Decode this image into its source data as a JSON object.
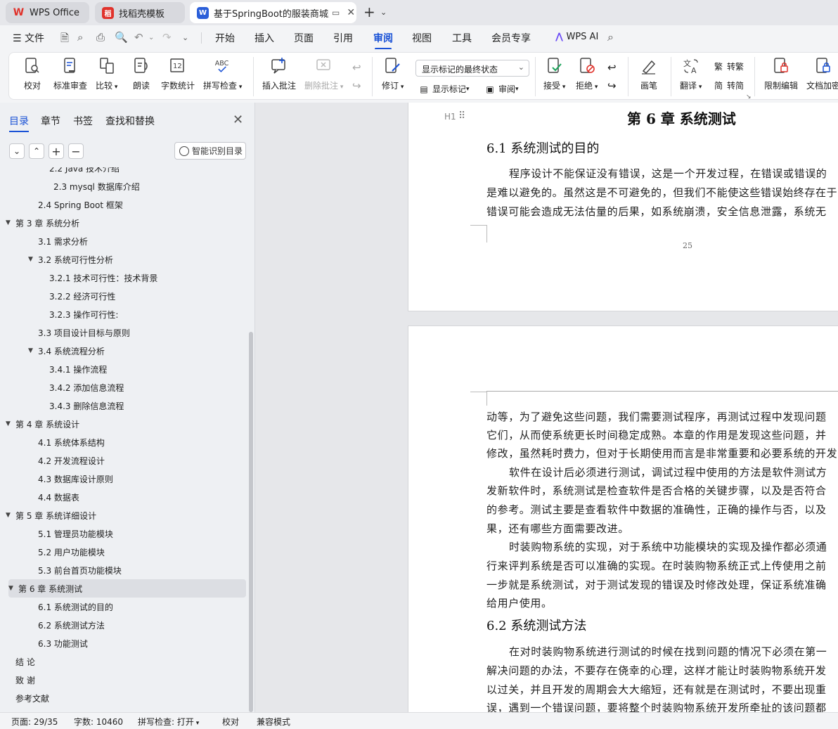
{
  "tabs": [
    {
      "label": "WPS Office"
    },
    {
      "label": "找稻壳模板"
    },
    {
      "label": "基于SpringBoot的服装商城购"
    }
  ],
  "menu": {
    "file": "文件",
    "items": [
      "开始",
      "插入",
      "页面",
      "引用",
      "审阅",
      "视图",
      "工具",
      "会员专享"
    ],
    "active": "审阅",
    "ai": "WPS AI"
  },
  "ribbon": {
    "proofread": "校对",
    "std_review": "标准审查",
    "compare": "比较",
    "read_aloud": "朗读",
    "word_count": "字数统计",
    "spell_check": "拼写检查",
    "insert_comment": "插入批注",
    "delete_comment": "删除批注",
    "track_changes": "修订",
    "markup_state": "显示标记的最终状态",
    "show_markup": "显示标记",
    "review": "审阅",
    "accept": "接受",
    "reject": "拒绝",
    "ink": "画笔",
    "translate": "翻译",
    "to_traditional": "转繁",
    "to_simplified": "转简",
    "restrict_edit": "限制编辑",
    "doc_encrypt": "文档加密"
  },
  "sidebar": {
    "tabs": [
      "目录",
      "章节",
      "书签",
      "查找和替换"
    ],
    "active_tab": "目录",
    "smart_toc": "智能识别目录",
    "toc": [
      {
        "label": "2.2   Java 技术介绍",
        "level": 3
      },
      {
        "label": "2.3 mysql 数据库介绍",
        "level": 3
      },
      {
        "label": "2.4 Spring    Boot 框架",
        "level": 2
      },
      {
        "label": "第 3 章  系统分析",
        "level": 1,
        "expanded": true
      },
      {
        "label": "3.1  需求分析",
        "level": 2
      },
      {
        "label": "3.2  系统可行性分析",
        "level": 2,
        "expanded": true
      },
      {
        "label": "3.2.1 技术可行性：技术背景",
        "level": 3
      },
      {
        "label": "3.2.2 经济可行性",
        "level": 3
      },
      {
        "label": "3.2.3 操作可行性:",
        "level": 3
      },
      {
        "label": "3.3  项目设计目标与原则",
        "level": 2
      },
      {
        "label": "3.4 系统流程分析",
        "level": 2,
        "expanded": true
      },
      {
        "label": "3.4.1 操作流程",
        "level": 3
      },
      {
        "label": "3.4.2 添加信息流程",
        "level": 3
      },
      {
        "label": "3.4.3 删除信息流程",
        "level": 3
      },
      {
        "label": "第 4 章  系统设计",
        "level": 1,
        "expanded": true
      },
      {
        "label": "4.1  系统体系结构",
        "level": 2
      },
      {
        "label": "4.2 开发流程设计",
        "level": 2
      },
      {
        "label": "4.3  数据库设计原则",
        "level": 2
      },
      {
        "label": "4.4  数据表",
        "level": 2
      },
      {
        "label": "第 5 章  系统详细设计",
        "level": 1,
        "expanded": true
      },
      {
        "label": "5.1 管理员功能模块",
        "level": 2
      },
      {
        "label": "5.2 用户功能模块",
        "level": 2
      },
      {
        "label": "5.3 前台首页功能模块",
        "level": 2
      },
      {
        "label": "第 6 章    系统测试",
        "level": 1,
        "expanded": true,
        "selected": true
      },
      {
        "label": "6.1 系统测试的目的",
        "level": 2
      },
      {
        "label": "6.2 系统测试方法",
        "level": 2
      },
      {
        "label": "6.3 功能测试",
        "level": 2
      },
      {
        "label": "结    论",
        "level": 1
      },
      {
        "label": "致    谢",
        "level": 1
      },
      {
        "label": "参考文献",
        "level": 1
      }
    ]
  },
  "page1": {
    "heading_marker": "H1",
    "chapter_title": "第 6 章    系统测试",
    "section_title": "6.1 系统测试的目的",
    "lines": [
      "程序设计不能保证没有错误，这是一个开发过程，在错误或错误的",
      "是难以避免的。虽然这是不可避免的，但我们不能使这些错误始终存在于",
      "错误可能会造成无法估量的后果，如系统崩溃，安全信息泄露，系统无"
    ],
    "page_number": "25"
  },
  "page2": {
    "lines": [
      "动等，为了避免这些问题，我们需要测试程序，再测试过程中发现问题",
      "它们，从而使系统更长时间稳定成熟。本章的作用是发现这些问题，并",
      "修改，虽然耗时费力，但对于长期使用而言是非常重要和必要系统的开发",
      "软件在设计后必须进行测试，调试过程中使用的方法是软件测试方",
      "发新软件时，系统测试是检查软件是否合格的关键步骤，以及是否符合",
      "的参考。测试主要是查看软件中数据的准确性，正确的操作与否，以及",
      "果，还有哪些方面需要改进。",
      "时装购物系统的实现，对于系统中功能模块的实现及操作都必须通",
      "行来评判系统是否可以准确的实现。在时装购物系统正式上传使用之前",
      "一步就是系统测试，对于测试发现的错误及时修改处理，保证系统准确",
      "给用户使用。"
    ],
    "section_title": "6.2 系统测试方法",
    "lines2": [
      "在对时装购物系统进行测试的时候在找到问题的情况下必须在第一",
      "解决问题的办法，不要存在侥幸的心理，这样才能让时装购物系统开发",
      "以过关，并且开发的周期会大大缩短，还有就是在测试时，不要出现重",
      "误，遇到一个错误问题，要将整个时装购物系统开发所牵扯的该问题都"
    ]
  },
  "status": {
    "page": "页面: 29/35",
    "words": "字数: 10460",
    "spell": "拼写检查: 打开",
    "proof": "校对",
    "compat": "兼容模式"
  },
  "colors": {
    "accent": "#1a52d6",
    "wps_red": "#e0322b"
  }
}
